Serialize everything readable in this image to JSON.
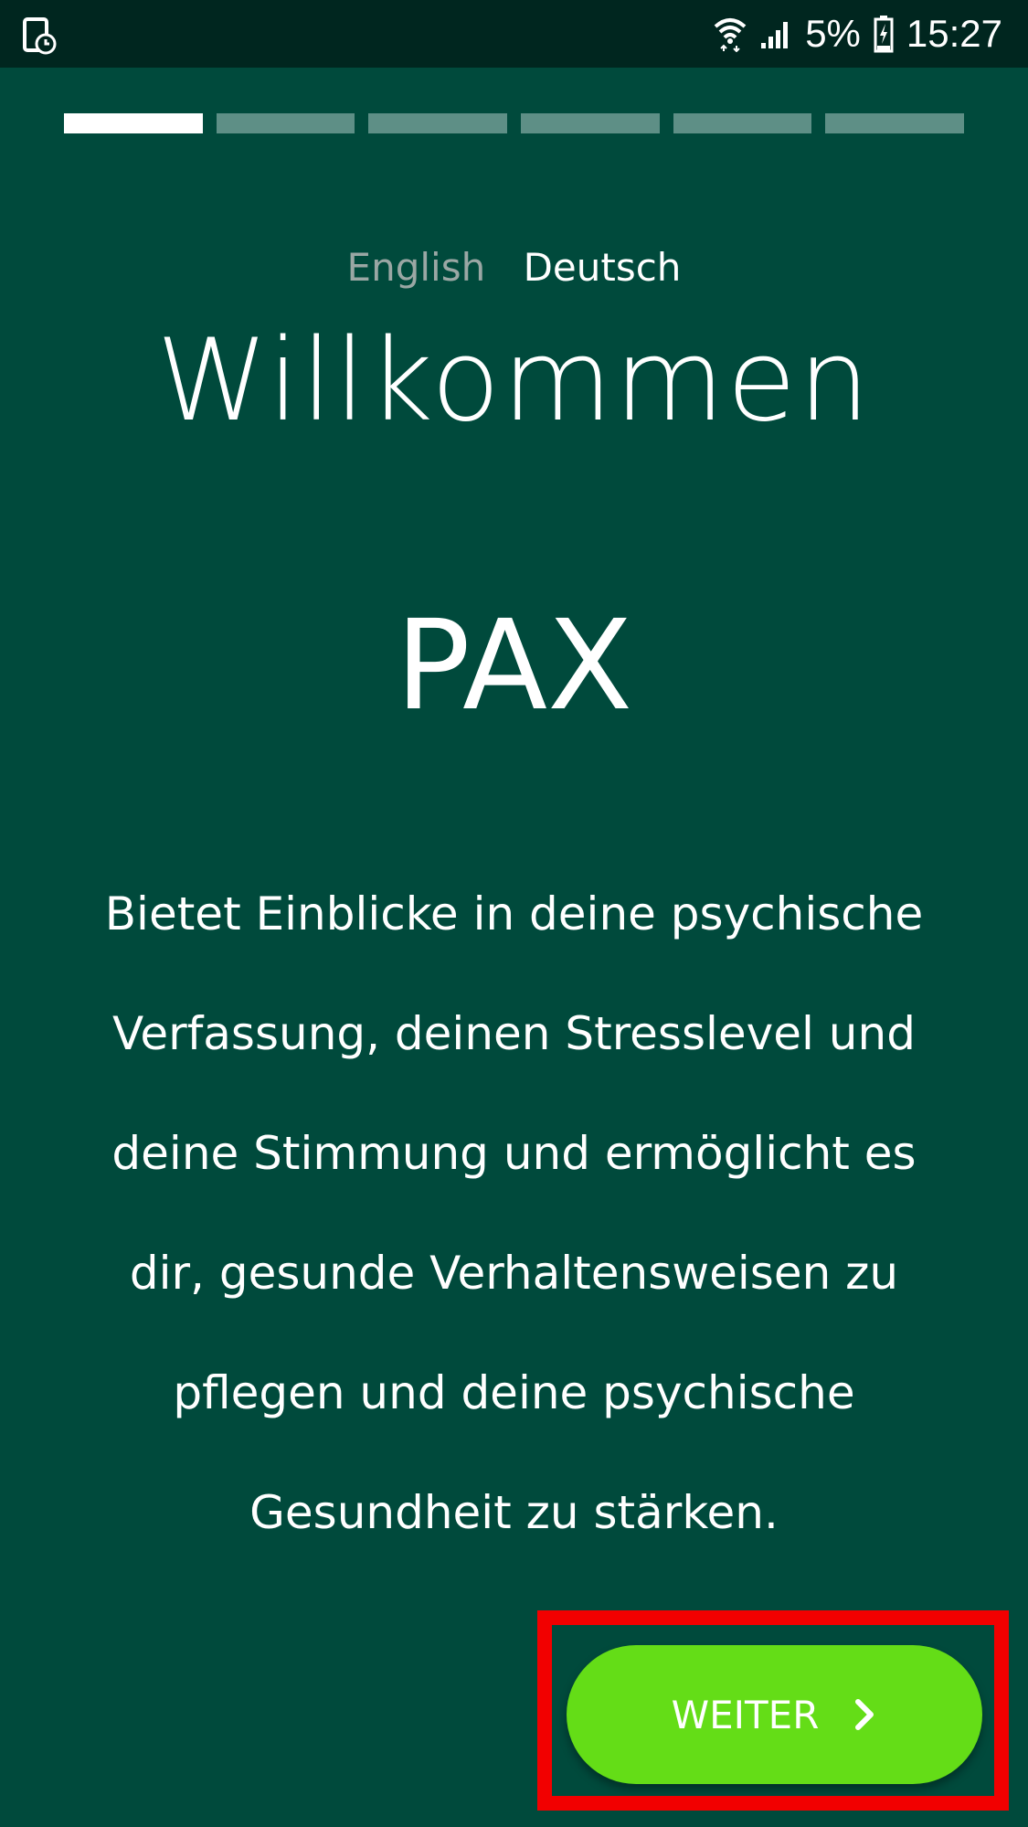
{
  "status_bar": {
    "left_icon": "screenshot-timer-icon",
    "wifi_icon": "wifi-icon",
    "signal_icon": "signal-icon",
    "battery_percent": "5%",
    "battery_icon": "battery-charging-icon",
    "time": "15:27"
  },
  "progress": {
    "total_steps": 6,
    "current_step": 1
  },
  "language": {
    "options": [
      "English",
      "Deutsch"
    ],
    "selected": "Deutsch"
  },
  "welcome": {
    "title": "Willkommen",
    "app_name": "PAX",
    "description": "Bietet Einblicke in deine psychische Verfassung, deinen Stresslevel und deine Stimmung und ermöglicht es dir, gesunde Verhaltensweisen zu pflegen und deine psychische Gesundheit zu stärken."
  },
  "actions": {
    "next_label": "WEITER",
    "next_icon": "chevron-right-icon"
  },
  "colors": {
    "background": "#004a3c",
    "status_bar": "#00261f",
    "button": "#64dd17",
    "highlight": "#f20000"
  }
}
